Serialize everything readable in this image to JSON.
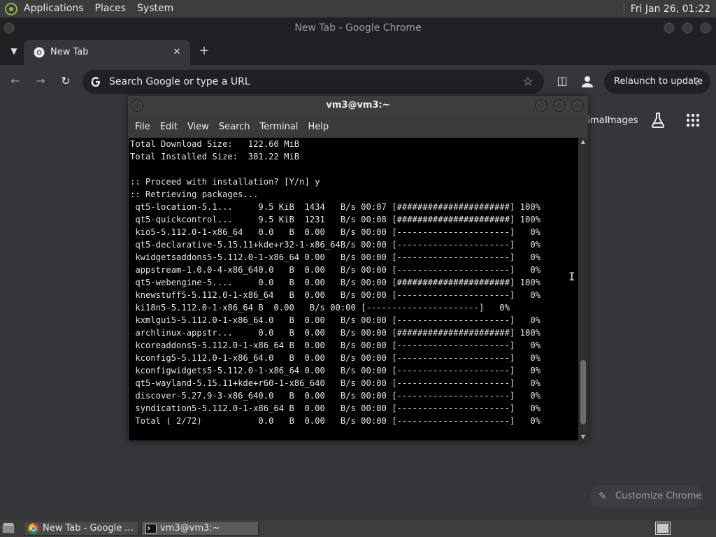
{
  "top_panel": {
    "menus": [
      "Applications",
      "Places",
      "System"
    ],
    "clock": "Fri Jan 26, 01:22"
  },
  "chrome": {
    "window_title": "New Tab - Google Chrome",
    "tab_title": "New Tab",
    "omnibox_placeholder": "Search Google or type a URL",
    "relaunch_label": "Relaunch to update",
    "ntp": {
      "gmail_label": "Gmail",
      "images_label": "Images",
      "customize_label": "Customize Chrome"
    }
  },
  "terminal": {
    "title": "vm3@vm3:~",
    "menu": [
      "File",
      "Edit",
      "View",
      "Search",
      "Terminal",
      "Help"
    ],
    "lines": [
      "Total Download Size:   122.60 MiB",
      "Total Installed Size:  381.22 MiB",
      "",
      ":: Proceed with installation? [Y/n] y",
      ":: Retrieving packages...",
      " qt5-location-5.1...     9.5 KiB  1434   B/s 00:07 [######################] 100%",
      " qt5-quickcontrol...     9.5 KiB  1231   B/s 00:08 [######################] 100%",
      " kio5-5.112.0-1-x86_64   0.0   B  0.00   B/s 00:00 [----------------------]   0%",
      " qt5-declarative-5.15.11+kde+r32-1-x86_64B/s 00:00 [----------------------]   0%",
      " kwidgetsaddons5-5.112.0-1-x86_64 0.00   B/s 00:00 [----------------------]   0%",
      " appstream-1.0.0-4-x86_640.0   B  0.00   B/s 00:00 [----------------------]   0%",
      " qt5-webengine-5....     0.0   B  0.00   B/s 00:00 [######################] 100%",
      " knewstuff5-5.112.0-1-x86_64   B  0.00   B/s 00:00 [----------------------]   0%",
      " ki18n5-5.112.0-1-x86_64 B  0.00   B/s 00:00 [----------------------]   0%",
      " kxmlgui5-5.112.0-1-x86_64.0   B  0.00   B/s 00:00 [----------------------]   0%",
      " archlinux-appstr...     0.0   B  0.00   B/s 00:00 [######################] 100%",
      " kcoreaddons5-5.112.0-1-x86_64 B  0.00   B/s 00:00 [----------------------]   0%",
      " kconfig5-5.112.0-1-x86_64.0   B  0.00   B/s 00:00 [----------------------]   0%",
      " kconfigwidgets5-5.112.0-1-x86_64 0.00   B/s 00:00 [----------------------]   0%",
      " qt5-wayland-5.15.11+kde+r60-1-x86_640   B/s 00:00 [----------------------]   0%",
      " discover-5.27.9-3-x86_640.0   B  0.00   B/s 00:00 [----------------------]   0%",
      " syndication5-5.112.0-1-x86_64 B  0.00   B/s 00:00 [----------------------]   0%",
      " Total ( 2/72)           0.0   B  0.00   B/s 00:00 [----------------------]   0%"
    ]
  },
  "taskbar": {
    "tasks": [
      "New Tab - Google ...",
      "vm3@vm3:~"
    ]
  }
}
